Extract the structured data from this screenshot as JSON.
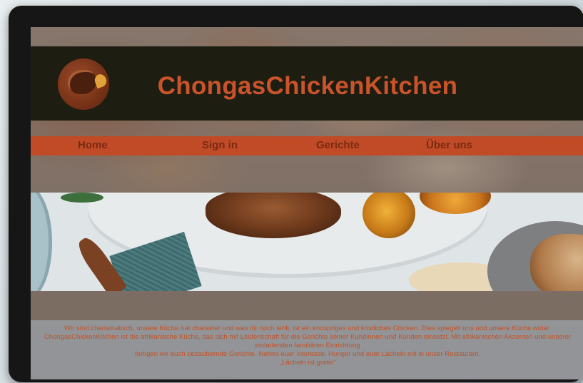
{
  "site": {
    "title": "ChongasChickenKitchen",
    "logo_icon": "chicken-logo-icon"
  },
  "nav": {
    "items": [
      {
        "label": "Home"
      },
      {
        "label": "Sign in"
      },
      {
        "label": "Gerichte"
      },
      {
        "label": "Über uns"
      }
    ]
  },
  "hero": {
    "image": "grilled-chicken-lemon-plate-photo"
  },
  "intro": {
    "paragraph": "Wir sind charismatisch, unsere Küche hat charakter und was dir noch fehlt, ist ein knuspriges und köstliches Chicken. Dies spiegelt uns und unsere Küche wider. ChongasChickenKitchen ist die afrikanische Küche, das sich mit Leidenschaft für die Gerichte seiner Kundinnen und Kunden einsetzt. Mit afrikanischen Akzenten und unserer einladenden familiären Einrichtung",
    "line2": "fertigen wir euch bezaubernde Gerichte. Nehmt euer Interesse, Hunger und euer Lächeln mit in unser Restaurant.",
    "line3": "„Lächeln ist gratis“"
  },
  "colors": {
    "header_bg": "#1d1d12",
    "accent": "#c9532a",
    "nav_bg": "#c04b26",
    "nav_text": "#7a2a12"
  }
}
